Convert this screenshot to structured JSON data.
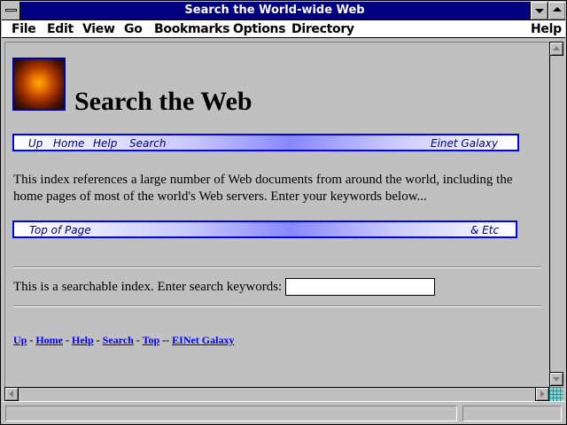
{
  "window": {
    "title": "Search the World-wide Web"
  },
  "menu": {
    "file": "File",
    "edit": "Edit",
    "view": "View",
    "go": "Go",
    "bookmarks": "Bookmarks",
    "options": "Options",
    "directory": "Directory",
    "help": "Help"
  },
  "page": {
    "logo_icon": "galaxy-icon",
    "title": "Search the Web",
    "nav1": {
      "up": "Up",
      "home": "Home",
      "help": "Help",
      "search": "Search",
      "galaxy": "Einet Galaxy"
    },
    "intro": "This index references a large number of Web documents from around the world, including the home pages of most of the world's Web servers. Enter your keywords below...",
    "nav2": {
      "top": "Top of Page",
      "etc": "& Etc"
    },
    "search_label": "This is a searchable index. Enter search keywords:",
    "search_value": "",
    "footer": {
      "up": "Up",
      "home": "Home",
      "help": "Help",
      "search": "Search",
      "top": "Top",
      "galaxy": "EINet Galaxy"
    }
  },
  "colors": {
    "titlebar": "#000080",
    "link": "#0000ff",
    "chrome": "#c0c0c0"
  }
}
